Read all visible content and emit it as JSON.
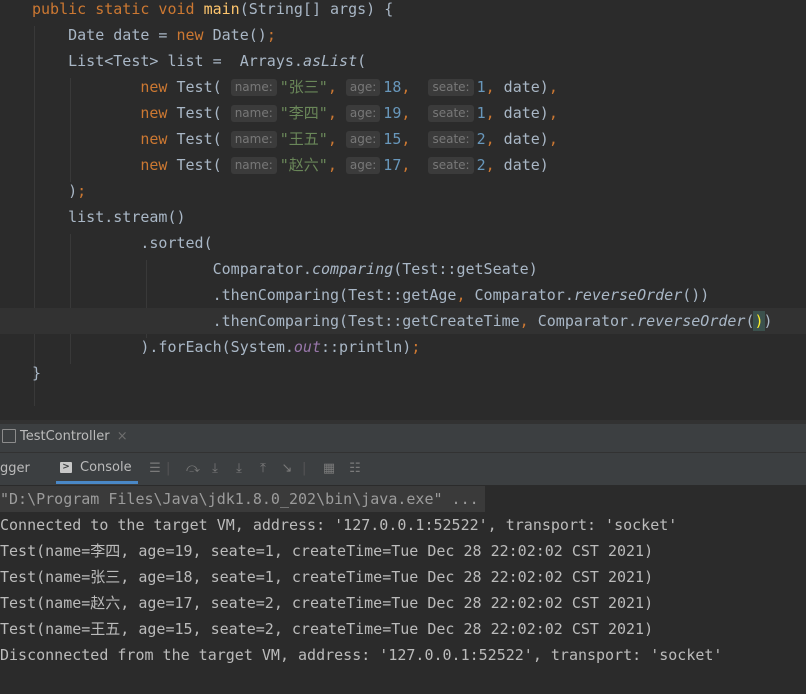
{
  "editor": {
    "lines": [
      {
        "parts": [
          [
            "kw",
            "public static void "
          ],
          [
            "fn",
            "main"
          ],
          [
            "",
            "(String[] args) {"
          ]
        ]
      },
      {
        "parts": [
          [
            "",
            "    Date date = "
          ],
          [
            "kw",
            "new "
          ],
          [
            "",
            "Date()"
          ],
          [
            "kw",
            ";"
          ]
        ]
      },
      {
        "parts": [
          [
            "",
            "    List<Test> list =  Arrays."
          ],
          [
            "it",
            "asList"
          ],
          [
            "",
            "("
          ]
        ]
      },
      {
        "parts": [
          [
            "kw",
            "            new "
          ],
          [
            "",
            "Test( "
          ],
          [
            "hint",
            "name:"
          ],
          [
            "str",
            "\"张三\""
          ],
          [
            "kw",
            ", "
          ],
          [
            "hint",
            "age:"
          ],
          [
            "num",
            "18"
          ],
          [
            "kw",
            ",  "
          ],
          [
            "hint",
            "seate:"
          ],
          [
            "num",
            "1"
          ],
          [
            "kw",
            ", "
          ],
          [
            "",
            "date)"
          ],
          [
            "kw",
            ","
          ]
        ]
      },
      {
        "parts": [
          [
            "kw",
            "            new "
          ],
          [
            "",
            "Test( "
          ],
          [
            "hint",
            "name:"
          ],
          [
            "str",
            "\"李四\""
          ],
          [
            "kw",
            ", "
          ],
          [
            "hint",
            "age:"
          ],
          [
            "num",
            "19"
          ],
          [
            "kw",
            ",  "
          ],
          [
            "hint",
            "seate:"
          ],
          [
            "num",
            "1"
          ],
          [
            "kw",
            ", "
          ],
          [
            "",
            "date)"
          ],
          [
            "kw",
            ","
          ]
        ]
      },
      {
        "parts": [
          [
            "kw",
            "            new "
          ],
          [
            "",
            "Test( "
          ],
          [
            "hint",
            "name:"
          ],
          [
            "str",
            "\"王五\""
          ],
          [
            "kw",
            ", "
          ],
          [
            "hint",
            "age:"
          ],
          [
            "num",
            "15"
          ],
          [
            "kw",
            ",  "
          ],
          [
            "hint",
            "seate:"
          ],
          [
            "num",
            "2"
          ],
          [
            "kw",
            ", "
          ],
          [
            "",
            "date)"
          ],
          [
            "kw",
            ","
          ]
        ]
      },
      {
        "parts": [
          [
            "kw",
            "            new "
          ],
          [
            "",
            "Test( "
          ],
          [
            "hint",
            "name:"
          ],
          [
            "str",
            "\"赵六\""
          ],
          [
            "kw",
            ", "
          ],
          [
            "hint",
            "age:"
          ],
          [
            "num",
            "17"
          ],
          [
            "kw",
            ",  "
          ],
          [
            "hint",
            "seate:"
          ],
          [
            "num",
            "2"
          ],
          [
            "kw",
            ", "
          ],
          [
            "",
            "date)"
          ]
        ]
      },
      {
        "parts": [
          [
            "",
            "    )"
          ],
          [
            "kw",
            ";"
          ]
        ]
      },
      {
        "parts": [
          [
            "",
            "    list.stream()"
          ]
        ]
      },
      {
        "parts": [
          [
            "",
            "            .sorted("
          ]
        ]
      },
      {
        "parts": [
          [
            "",
            "                    Comparator."
          ],
          [
            "it",
            "comparing"
          ],
          [
            "",
            "(Test::getSeate)"
          ]
        ]
      },
      {
        "parts": [
          [
            "",
            "                    .thenComparing(Test::getAge"
          ],
          [
            "kw",
            ", "
          ],
          [
            "",
            "Comparator."
          ],
          [
            "it",
            "reverseOrder"
          ],
          [
            "",
            "())"
          ]
        ]
      },
      {
        "parts": [
          [
            "",
            "                    .thenComparing(Test::getCreateTime"
          ],
          [
            "kw",
            ", "
          ],
          [
            "",
            "Comparator."
          ],
          [
            "it",
            "reverseOrder"
          ],
          [
            "",
            "("
          ],
          [
            "brace",
            ")"
          ],
          [
            "",
            ")"
          ]
        ]
      },
      {
        "parts": [
          [
            "",
            "            ).forEach(System."
          ],
          [
            "field",
            "out"
          ],
          [
            "",
            "::println)"
          ],
          [
            "kw",
            ";"
          ]
        ]
      },
      {
        "parts": [
          [
            "",
            "}"
          ]
        ]
      }
    ]
  },
  "run_panel": {
    "title": "TestController",
    "close_glyph": "×",
    "debugger_tab": "gger",
    "console_tab": "Console"
  },
  "console": {
    "lines": [
      "\"D:\\Program Files\\Java\\jdk1.8.0_202\\bin\\java.exe\" ...",
      "Connected to the target VM, address: '127.0.0.1:52522', transport: 'socket'",
      "Test(name=李四, age=19, seate=1, createTime=Tue Dec 28 22:02:02 CST 2021)",
      "Test(name=张三, age=18, seate=1, createTime=Tue Dec 28 22:02:02 CST 2021)",
      "Test(name=赵六, age=17, seate=2, createTime=Tue Dec 28 22:02:02 CST 2021)",
      "Test(name=王五, age=15, seate=2, createTime=Tue Dec 28 22:02:02 CST 2021)",
      "Disconnected from the target VM, address: '127.0.0.1:52522', transport: 'socket'"
    ]
  },
  "colors": {
    "editor_bg": "#2b2b2b",
    "keyword": "#cc7832",
    "method": "#ffc66d",
    "string": "#6a8759",
    "number": "#6897bb",
    "field": "#9876aa",
    "text": "#a9b7c6"
  }
}
